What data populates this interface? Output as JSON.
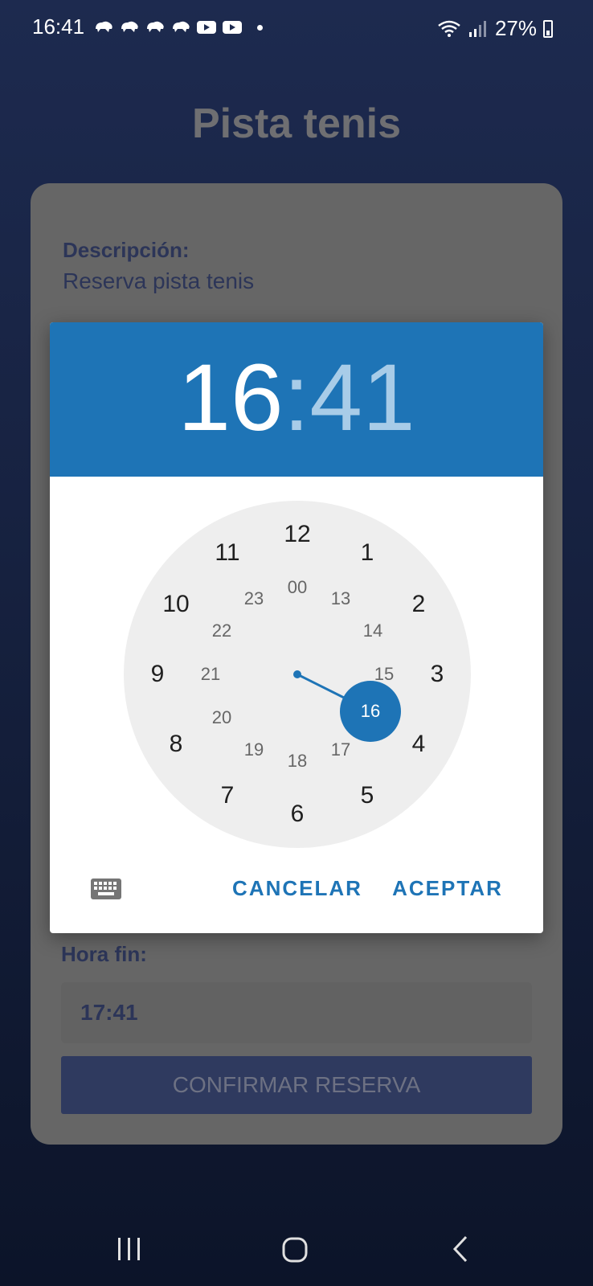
{
  "status_bar": {
    "time": "16:41",
    "battery": "27%",
    "notification_icons": [
      "app-icon",
      "app-icon",
      "app-icon",
      "app-icon",
      "youtube-icon",
      "youtube-icon"
    ]
  },
  "page": {
    "title": "Pista tenis"
  },
  "card": {
    "description_label": "Descripción:",
    "description_value": "Reserva pista tenis",
    "end_time_label": "Hora fin:",
    "end_time_value": "17:41",
    "confirm_label": "CONFIRMAR RESERVA"
  },
  "time_picker": {
    "hour": "16",
    "separator": ":",
    "minute": "41",
    "outer_numbers": [
      "12",
      "1",
      "2",
      "3",
      "4",
      "5",
      "6",
      "7",
      "8",
      "9",
      "10",
      "11"
    ],
    "inner_numbers": [
      "00",
      "13",
      "14",
      "15",
      "16",
      "17",
      "18",
      "19",
      "20",
      "21",
      "22",
      "23"
    ],
    "selected_hour": "16",
    "cancel_label": "CANCELAR",
    "accept_label": "ACEPTAR",
    "accent_color": "#1e74b6"
  }
}
